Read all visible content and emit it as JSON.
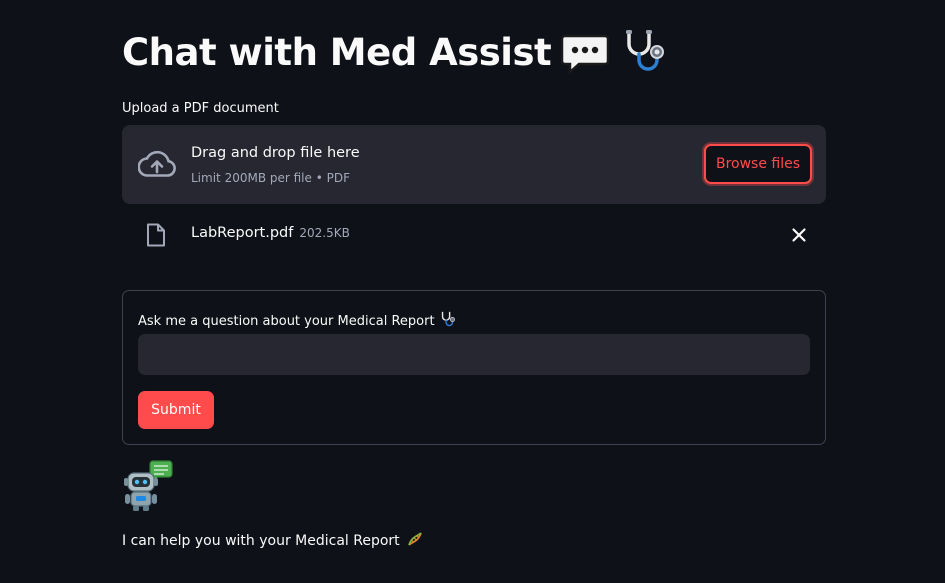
{
  "header": {
    "title": "Chat with Med Assist",
    "title_icons": [
      "speech-balloon-icon",
      "stethoscope-icon"
    ]
  },
  "uploader": {
    "label": "Upload a PDF document",
    "drop_text": "Drag and drop file here",
    "limit_text": "Limit 200MB per file • PDF",
    "browse_label": "Browse files",
    "icon": "cloud-upload-icon"
  },
  "uploaded_file": {
    "name": "LabReport.pdf",
    "size": "202.5KB",
    "icon": "file-icon",
    "remove_icon": "close-icon"
  },
  "question_form": {
    "label": "Ask me a question about your Medical Report",
    "label_icon": "stethoscope-icon",
    "input_value": "",
    "submit_label": "Submit"
  },
  "assistant": {
    "avatar": "robot-chat-icon",
    "message": "I can help you with your Medical Report",
    "message_icon": "dna-icon"
  },
  "colors": {
    "background": "#0e1117",
    "surface": "#262730",
    "accent": "#ff4b4b",
    "text": "#fafafa",
    "muted_text": "#a3a8b8",
    "border": "#3d4150"
  }
}
